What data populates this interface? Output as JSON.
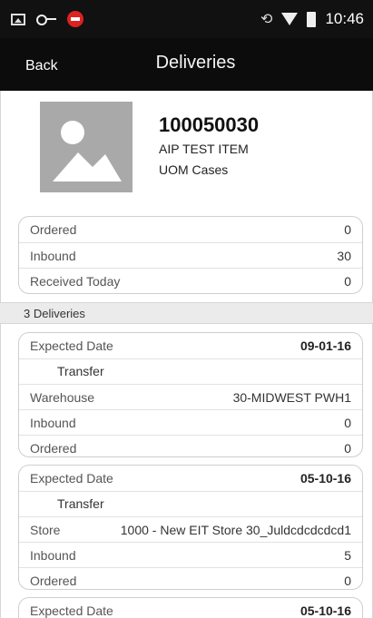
{
  "status_bar": {
    "time": "10:46",
    "icons_left": [
      "image-icon",
      "key-icon",
      "alert-icon"
    ],
    "icons_right": [
      "rotation-lock-icon",
      "wifi-icon",
      "battery-icon"
    ]
  },
  "header": {
    "back_label": "Back",
    "title": "Deliveries"
  },
  "item": {
    "number": "100050030",
    "description": "AIP TEST ITEM",
    "uom": "UOM Cases",
    "image": "placeholder-image-icon"
  },
  "summary": {
    "rows": [
      {
        "label": "Ordered",
        "value": "0"
      },
      {
        "label": "Inbound",
        "value": "30"
      },
      {
        "label": "Received Today",
        "value": "0"
      }
    ]
  },
  "deliveries_header": "3 Deliveries",
  "deliveries": [
    {
      "expected_label": "Expected Date",
      "expected_date": "09-01-16",
      "type": "Transfer",
      "source_label": "Warehouse",
      "source_value": "30-MIDWEST PWH1",
      "inbound_label": "Inbound",
      "inbound_value": "0",
      "ordered_label": "Ordered",
      "ordered_value": "0"
    },
    {
      "expected_label": "Expected Date",
      "expected_date": "05-10-16",
      "type": "Transfer",
      "source_label": "Store",
      "source_value": "1000 - New EIT Store 30_Juldcdcdcdcd1",
      "inbound_label": "Inbound",
      "inbound_value": "5",
      "ordered_label": "Ordered",
      "ordered_value": "0"
    },
    {
      "expected_label": "Expected Date",
      "expected_date": "05-10-16"
    }
  ],
  "colors": {
    "header_bg": "#0c0c0c",
    "status_bg": "#111111",
    "section_bg": "#ebebeb",
    "alert": "#dd2222"
  }
}
